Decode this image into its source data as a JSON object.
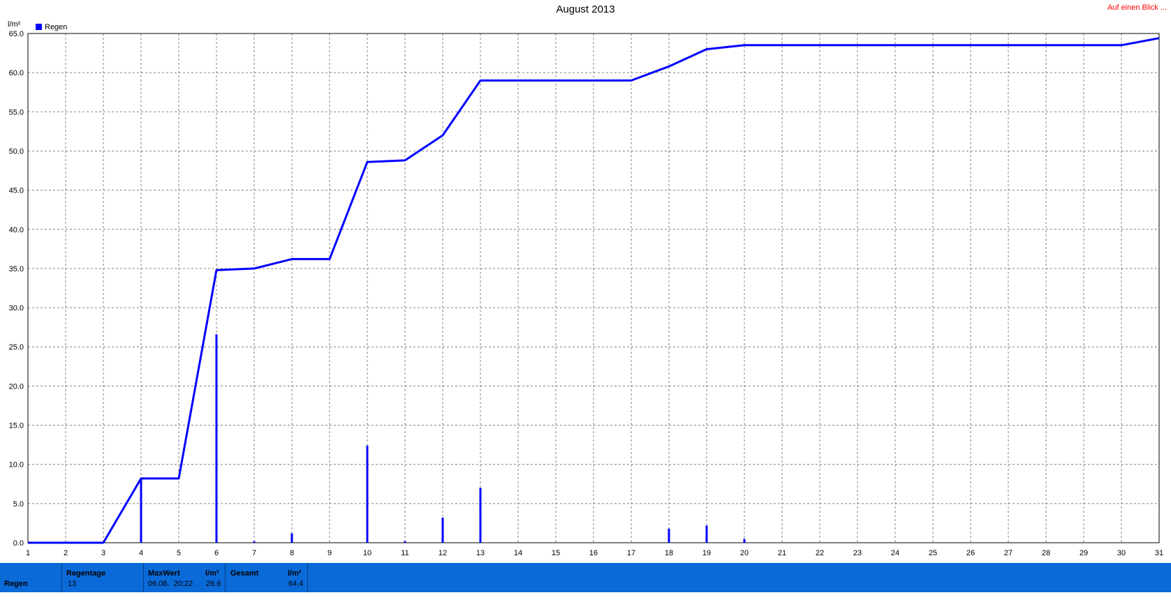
{
  "chart_data": {
    "type": "line",
    "title": "August 2013",
    "ylabel": "l/m²",
    "xlim": [
      1,
      31
    ],
    "ylim": [
      0,
      65
    ],
    "x_ticks": [
      "1",
      "2",
      "3",
      "4",
      "5",
      "6",
      "7",
      "8",
      "9",
      "10",
      "11",
      "12",
      "13",
      "14",
      "15",
      "16",
      "17",
      "18",
      "19",
      "20",
      "21",
      "22",
      "23",
      "24",
      "25",
      "26",
      "27",
      "28",
      "29",
      "30",
      "31"
    ],
    "y_ticks": [
      "0.0",
      "5.0",
      "10.0",
      "15.0",
      "20.0",
      "25.0",
      "30.0",
      "35.0",
      "40.0",
      "45.0",
      "50.0",
      "55.0",
      "60.0",
      "65.0"
    ],
    "grid": true,
    "legend_position": "top-left",
    "series": [
      {
        "name": "Regen",
        "kind": "cumulative-line",
        "color": "#0000ff",
        "points": [
          [
            1,
            0
          ],
          [
            3,
            0
          ],
          [
            4,
            8.2
          ],
          [
            5,
            8.2
          ],
          [
            6,
            34.8
          ],
          [
            7,
            35.0
          ],
          [
            8,
            36.2
          ],
          [
            9,
            36.2
          ],
          [
            10,
            48.6
          ],
          [
            11,
            48.8
          ],
          [
            12,
            52.0
          ],
          [
            13,
            59.0
          ],
          [
            17,
            59.0
          ],
          [
            18,
            60.8
          ],
          [
            19,
            63.0
          ],
          [
            20,
            63.5
          ],
          [
            30,
            63.5
          ],
          [
            31,
            64.4
          ]
        ]
      },
      {
        "name": "Regen",
        "kind": "daily-bars",
        "color": "#0000ff",
        "points": [
          [
            4,
            8.2
          ],
          [
            6,
            26.6
          ],
          [
            7,
            0.2
          ],
          [
            8,
            1.2
          ],
          [
            10,
            12.4
          ],
          [
            11,
            0.2
          ],
          [
            12,
            3.2
          ],
          [
            13,
            7.0
          ],
          [
            18,
            1.8
          ],
          [
            19,
            2.2
          ],
          [
            20,
            0.5
          ]
        ]
      }
    ]
  },
  "legend": {
    "label": "Regen",
    "color": "#0000ff"
  },
  "link": {
    "label": "Auf einen Blick ..."
  },
  "status": {
    "row_label": "Regen",
    "regentage_label": "Regentage",
    "regentage_value": "13",
    "maxwert_label": "MaxWert",
    "maxwert_unit": "l/m²",
    "maxwert_date": "06.08.  20:22",
    "maxwert_value": "26.6",
    "gesamt_label": "Gesamt",
    "gesamt_unit": "l/m²",
    "gesamt_value": "64.4"
  },
  "colors": {
    "series": "#0000ff",
    "statusbar": "#0a6ad8",
    "link": "#ff0000"
  }
}
